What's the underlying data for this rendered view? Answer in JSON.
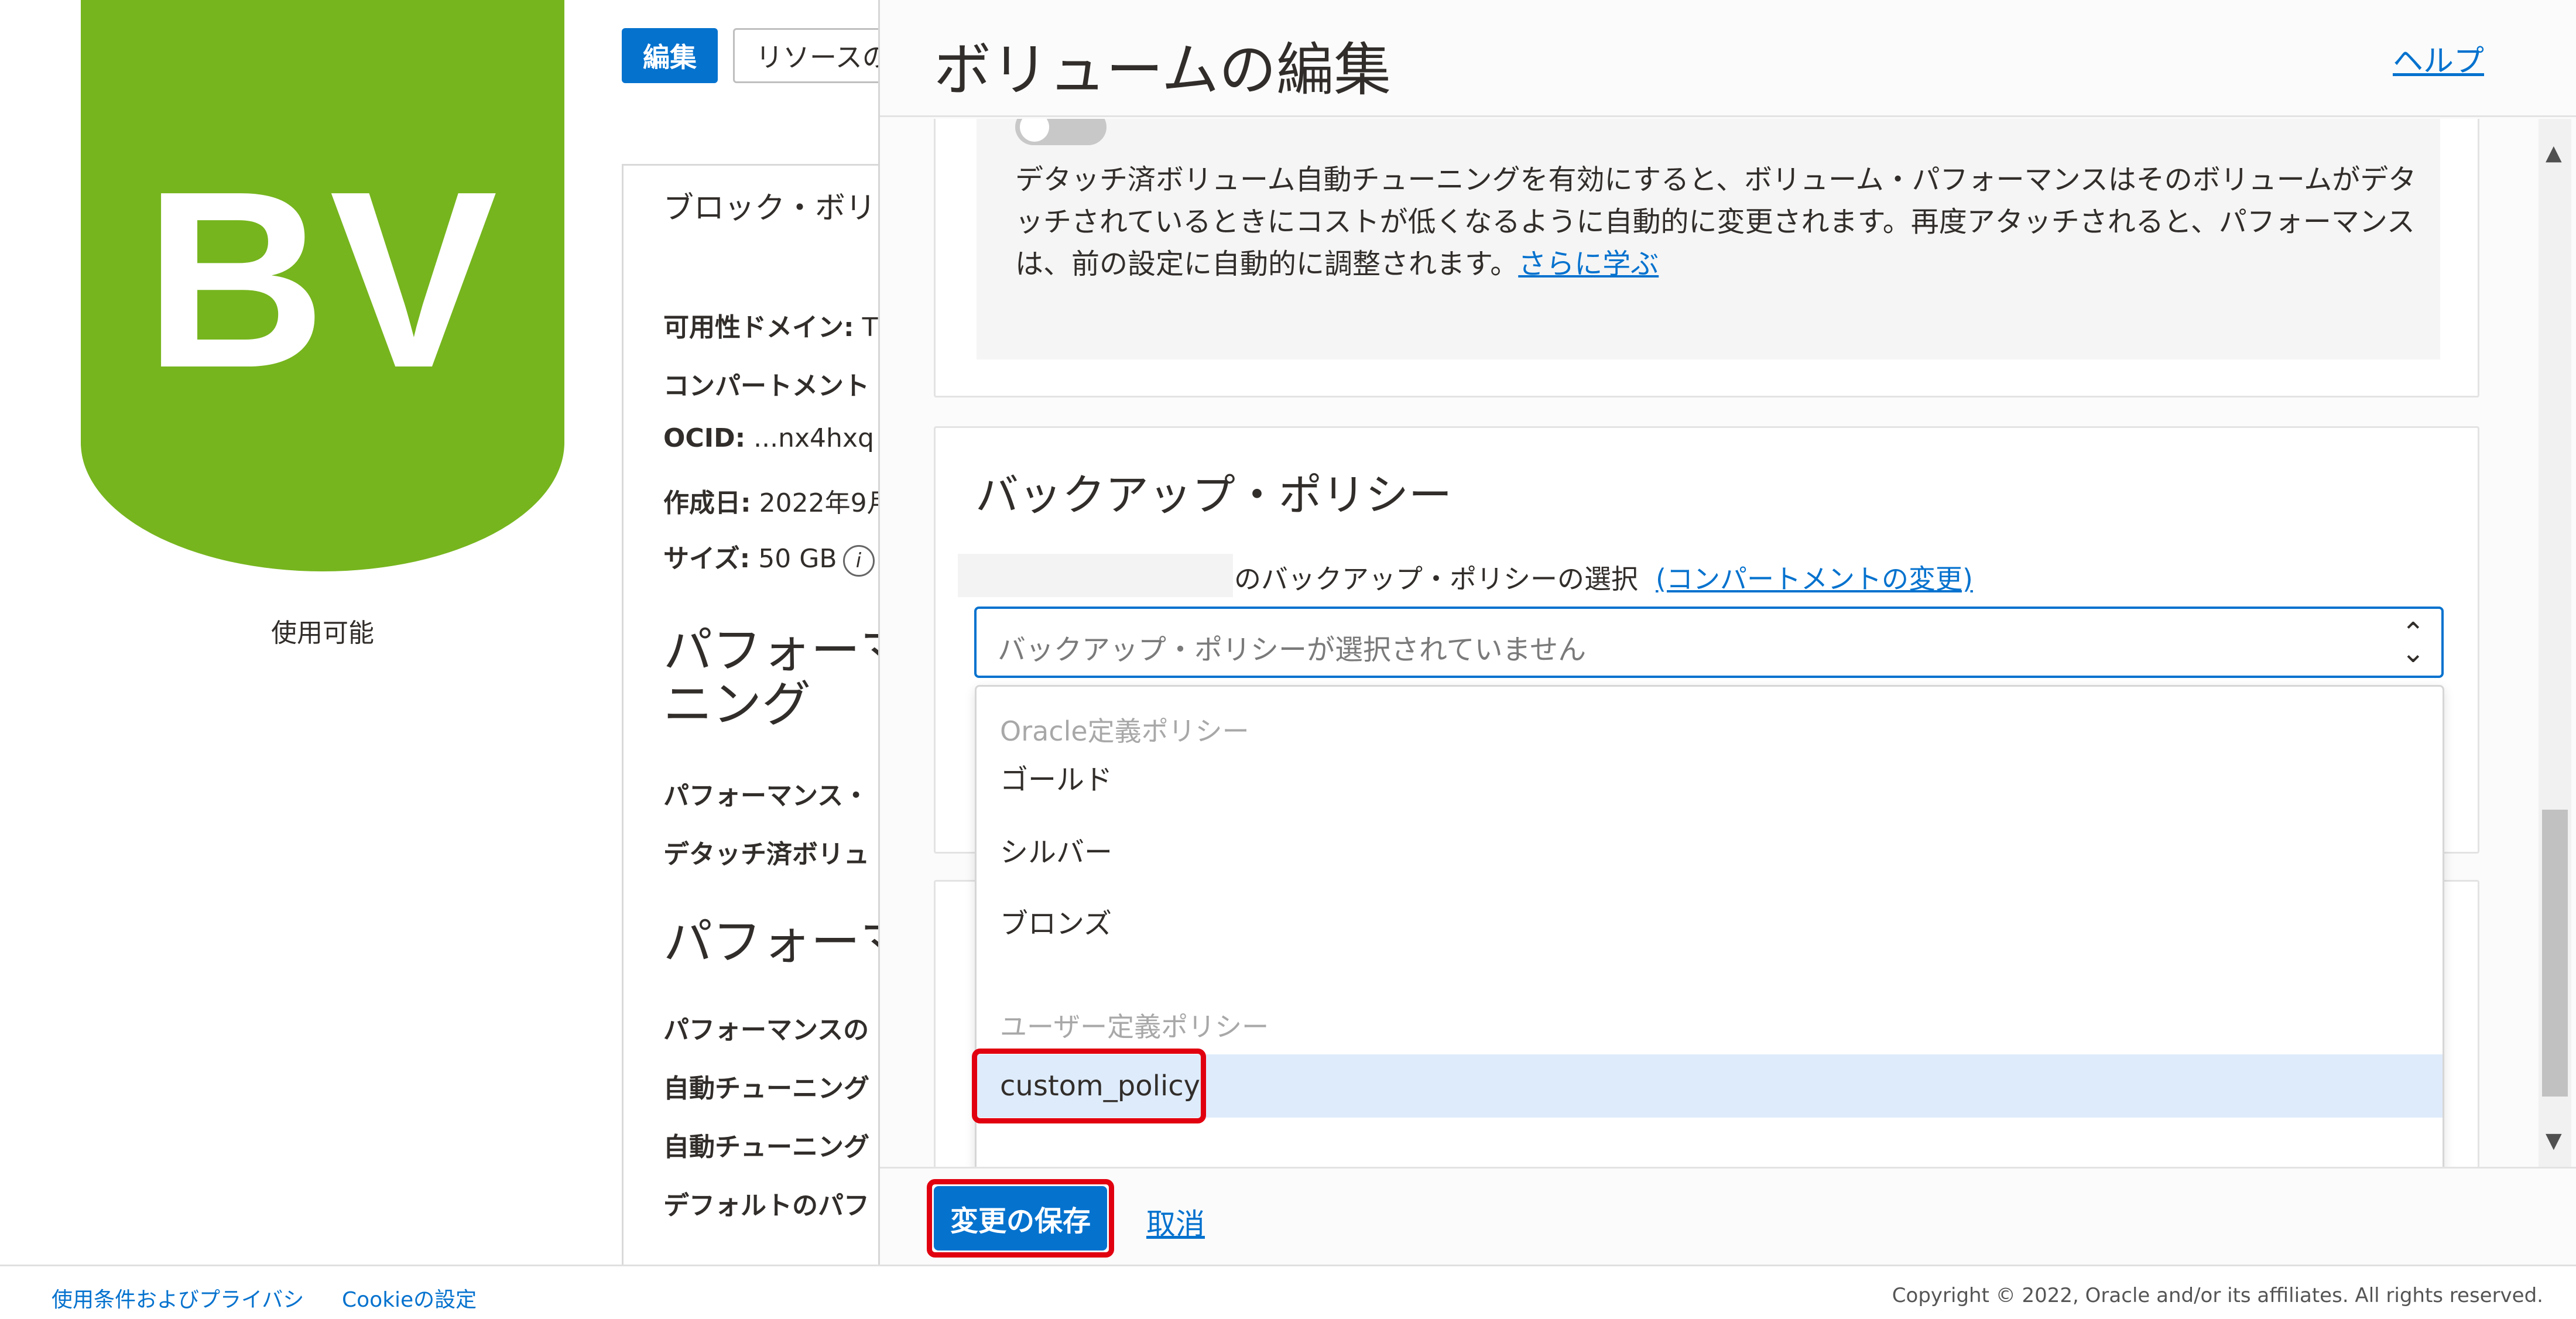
{
  "background": {
    "logo_text": "BV",
    "status": "使用可能",
    "edit_button": "編集",
    "move_button": "リソースの",
    "card_title": "ブロック・ボリ",
    "rows": [
      {
        "label": "可用性ドメイン:",
        "value": " T"
      },
      {
        "label": "コンパートメント",
        "value": ""
      },
      {
        "label": "OCID:",
        "value": " ...nx4hxq"
      },
      {
        "label": "作成日:",
        "value": " 2022年9月"
      },
      {
        "label": "サイズ:",
        "value": " 50 GB"
      }
    ],
    "heading1_line1": "パフォーマ",
    "heading1_line2": "ニング",
    "rows2": [
      {
        "label": "パフォーマンス・",
        "value": ""
      },
      {
        "label": "デタッチ済ボリュ",
        "value": ""
      }
    ],
    "heading2": "パフォーマ",
    "rows3": [
      {
        "label": "パフォーマンスの",
        "value": ""
      },
      {
        "label": "自動チューニング",
        "value": ""
      },
      {
        "label": "自動チューニング",
        "value": ""
      },
      {
        "label": "デフォルトのパフ",
        "value": ""
      }
    ]
  },
  "panel": {
    "title": "ボリュームの編集",
    "help_link": "ヘルプ",
    "tuning_text": "デタッチ済ボリューム自動チューニングを有効にすると、ボリューム・パフォーマンスはそのボリュームがデタッチされているときにコストが低くなるように自動的に変更されます。再度アタッチされると、パフォーマンスは、前の設定に自動的に調整されます。",
    "tuning_learn_more": "さらに学ぶ",
    "backup_title": "バックアップ・ポリシー",
    "select_label": "のバックアップ・ポリシーの選択",
    "change_compartment": "(コンパートメントの変更)",
    "select_placeholder": "バックアップ・ポリシーが選択されていません",
    "dropdown": {
      "group_oracle": "Oracle定義ポリシー",
      "items_oracle": [
        "ゴールド",
        "シルバー",
        "ブロンズ"
      ],
      "group_user": "ユーザー定義ポリシー",
      "items_user": [
        "custom_policy"
      ]
    },
    "save_button": "変更の保存",
    "cancel_link": "取消"
  },
  "footer": {
    "terms": "使用条件およびプライバシ",
    "cookies": "Cookieの設定",
    "copyright": "Copyright © 2022, Oracle and/or its affiliates. All rights reserved."
  },
  "colors": {
    "brand_green": "#76b51e",
    "accent_blue": "#0572ce",
    "highlight_red": "#e1000f",
    "selected_bg": "#deebfb"
  }
}
